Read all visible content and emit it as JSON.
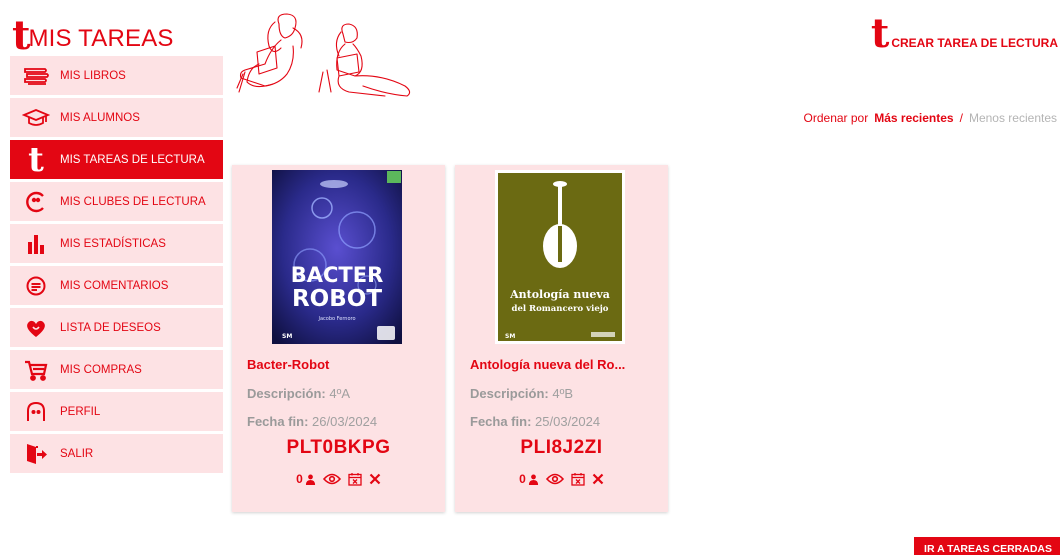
{
  "brand": {
    "logo": "t",
    "title": "MIS TAREAS"
  },
  "sidebar": {
    "items": [
      {
        "label": "MIS LIBROS",
        "icon": "books-icon"
      },
      {
        "label": "MIS ALUMNOS",
        "icon": "graduation-cap-icon"
      },
      {
        "label": "MIS TAREAS DE LECTURA",
        "icon": "t-logo-icon",
        "active": true
      },
      {
        "label": "MIS CLUBES DE LECTURA",
        "icon": "club-icon"
      },
      {
        "label": "MIS ESTADÍSTICAS",
        "icon": "bar-stats-icon"
      },
      {
        "label": "MIS COMENTARIOS",
        "icon": "comment-icon"
      },
      {
        "label": "LISTA DE DESEOS",
        "icon": "heart-icon"
      },
      {
        "label": "MIS COMPRAS",
        "icon": "cart-icon"
      },
      {
        "label": "PERFIL",
        "icon": "profile-icon"
      },
      {
        "label": "SALIR",
        "icon": "exit-icon"
      }
    ]
  },
  "header": {
    "create_logo": "t",
    "create_label": "CREAR TAREA DE LECTURA"
  },
  "sort": {
    "prefix": "Ordenar por",
    "active": "Más recientes",
    "separator": "/",
    "inactive": "Menos recientes"
  },
  "cards": [
    {
      "title": "Bacter-Robot",
      "desc_key": "Descripción:",
      "desc": "4ºA",
      "date_key": "Fecha fin:",
      "date": "26/03/2024",
      "code": "PLT0BKPG",
      "count": "0",
      "cover": {
        "line1": "BACTER",
        "line2": "ROBOT",
        "author": "Jacobo Fernoro",
        "publisher": "SM"
      }
    },
    {
      "title": "Antología nueva del Ro...",
      "desc_key": "Descripción:",
      "desc": "4ºB",
      "date_key": "Fecha fin:",
      "date": "25/03/2024",
      "code": "PLI8J2ZI",
      "count": "0",
      "cover": {
        "line1": "Antología nueva",
        "line2": "del Romancero viejo",
        "publisher": "SM"
      }
    }
  ],
  "footer": {
    "closed_label": "IR A TAREAS CERRADAS"
  },
  "colors": {
    "accent": "#e30613",
    "card_bg": "#fde2e4",
    "muted": "#a0a0a0"
  }
}
